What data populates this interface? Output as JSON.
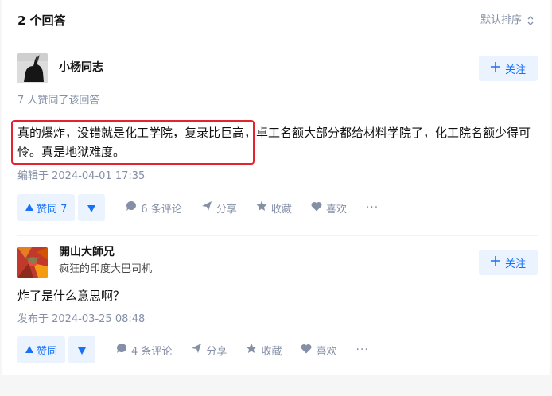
{
  "header": {
    "title": "2 个回答",
    "sort_label": "默认排序"
  },
  "answers": [
    {
      "author": "小杨同志",
      "bio": "",
      "follow_label": "关注",
      "voters_text": "7 人赞同了该回答",
      "content_line1": "真的爆炸，没错就是化工学院，复录比巨高，卓工名额大部分都给材料学院了，化工院名额少得可",
      "content_line2": "怜。真是地狱难度。",
      "time": "编辑于 2024-04-01 17:35",
      "vote_label": "赞同 7",
      "comments": "6 条评论",
      "share": "分享",
      "collect": "收藏",
      "like": "喜欢",
      "more": "···"
    },
    {
      "author": "開山大師兄",
      "bio": "疯狂的印度大巴司机",
      "follow_label": "关注",
      "content_line1": "炸了是什么意思啊？",
      "time": "发布于 2024-03-25 08:48",
      "vote_label": "赞同",
      "comments": "4 条评论",
      "share": "分享",
      "collect": "收藏",
      "like": "喜欢",
      "more": "···"
    }
  ],
  "colors": {
    "accent": "#1772f6",
    "accent_bg": "#ebf3ff",
    "muted": "#8590a6",
    "highlight": "#e4232e"
  }
}
